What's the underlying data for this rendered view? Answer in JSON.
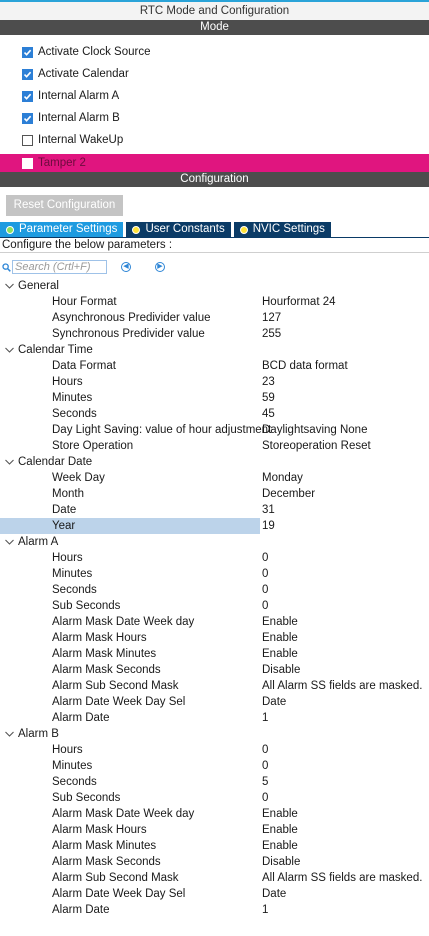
{
  "title": "RTC Mode and Configuration",
  "mode": {
    "header": "Mode",
    "items": [
      {
        "label": "Activate Clock Source",
        "checked": true
      },
      {
        "label": "Activate Calendar",
        "checked": true
      },
      {
        "label": "Internal Alarm A",
        "checked": true
      },
      {
        "label": "Internal Alarm B",
        "checked": true
      },
      {
        "label": "Internal WakeUp",
        "checked": false
      },
      {
        "label": "Tamper 2",
        "checked": false
      }
    ]
  },
  "configuration": {
    "header": "Configuration",
    "reset_label": "Reset Configuration",
    "tabs": [
      "Parameter Settings",
      "User Constants",
      "NVIC Settings"
    ],
    "hint": "Configure the below parameters :",
    "search_placeholder": "Search (Crtl+F)"
  },
  "groups": [
    {
      "name": "General",
      "params": [
        {
          "name": "Hour Format",
          "value": "Hourformat 24"
        },
        {
          "name": "Asynchronous Predivider value",
          "value": "127"
        },
        {
          "name": "Synchronous Predivider value",
          "value": "255"
        }
      ]
    },
    {
      "name": "Calendar Time",
      "params": [
        {
          "name": "Data Format",
          "value": "BCD data format"
        },
        {
          "name": "Hours",
          "value": "23"
        },
        {
          "name": "Minutes",
          "value": "59"
        },
        {
          "name": "Seconds",
          "value": "45"
        },
        {
          "name": "Day Light Saving: value of hour adjustment",
          "value": "Daylightsaving None"
        },
        {
          "name": "Store Operation",
          "value": "Storeoperation Reset"
        }
      ]
    },
    {
      "name": "Calendar Date",
      "params": [
        {
          "name": "Week Day",
          "value": "Monday"
        },
        {
          "name": "Month",
          "value": "December"
        },
        {
          "name": "Date",
          "value": "31"
        },
        {
          "name": "Year",
          "value": "19",
          "selected": true
        }
      ]
    },
    {
      "name": "Alarm A",
      "params": [
        {
          "name": "Hours",
          "value": "0"
        },
        {
          "name": "Minutes",
          "value": "0"
        },
        {
          "name": "Seconds",
          "value": "0"
        },
        {
          "name": "Sub Seconds",
          "value": "0"
        },
        {
          "name": "Alarm Mask Date Week day",
          "value": "Enable"
        },
        {
          "name": "Alarm Mask Hours",
          "value": "Enable"
        },
        {
          "name": "Alarm Mask Minutes",
          "value": "Enable"
        },
        {
          "name": "Alarm Mask Seconds",
          "value": "Disable"
        },
        {
          "name": "Alarm Sub Second Mask",
          "value": "All Alarm SS fields are masked."
        },
        {
          "name": "Alarm Date Week Day Sel",
          "value": "Date"
        },
        {
          "name": "Alarm Date",
          "value": "1"
        }
      ]
    },
    {
      "name": "Alarm B",
      "params": [
        {
          "name": "Hours",
          "value": "0"
        },
        {
          "name": "Minutes",
          "value": "0"
        },
        {
          "name": "Seconds",
          "value": "5"
        },
        {
          "name": "Sub Seconds",
          "value": "0"
        },
        {
          "name": "Alarm Mask Date Week day",
          "value": "Enable"
        },
        {
          "name": "Alarm Mask Hours",
          "value": "Enable"
        },
        {
          "name": "Alarm Mask Minutes",
          "value": "Enable"
        },
        {
          "name": "Alarm Mask Seconds",
          "value": "Disable"
        },
        {
          "name": "Alarm Sub Second Mask",
          "value": "All Alarm SS fields are masked."
        },
        {
          "name": "Alarm Date Week Day Sel",
          "value": "Date"
        },
        {
          "name": "Alarm Date",
          "value": "1"
        }
      ]
    }
  ]
}
